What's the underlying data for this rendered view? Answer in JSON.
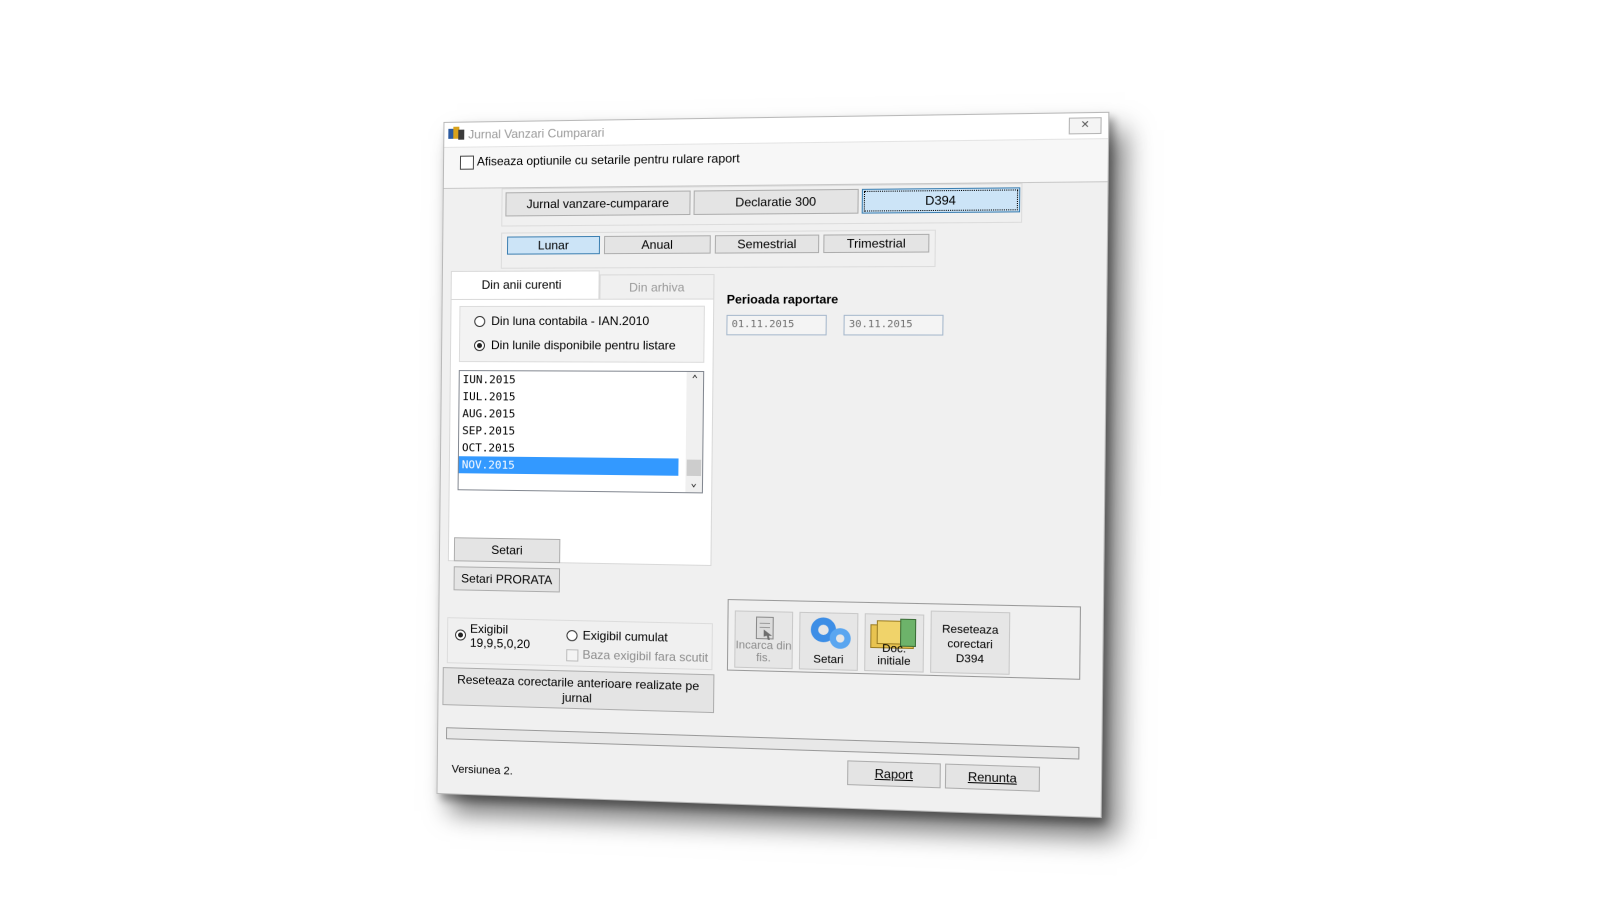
{
  "window": {
    "title": "Jurnal Vanzari Cumparari",
    "close_glyph": "✕"
  },
  "options": {
    "show_settings_label": "Afiseaza optiunile cu setarile pentru rulare raport",
    "checked": false
  },
  "report_types": [
    "Jurnal vanzare-cumparare",
    "Declaratie 300",
    "D394"
  ],
  "selected_report_type": "D394",
  "periods": [
    "Lunar",
    "Anual",
    "Semestrial",
    "Trimestrial"
  ],
  "selected_period": "Lunar",
  "tabs": [
    "Din anii curenti",
    "Din arhiva"
  ],
  "source": {
    "radio_contabila": "Din luna contabila - IAN.2010",
    "radio_disponibile": "Din lunile disponibile pentru listare",
    "selected": "disponibile"
  },
  "months": [
    "IUN.2015",
    "IUL.2015",
    "AUG.2015",
    "SEP.2015",
    "OCT.2015",
    "NOV.2015"
  ],
  "selected_month": "NOV.2015",
  "reporting_period": {
    "label": "Perioada raportare",
    "from": "01.11.2015",
    "to": "30.11.2015"
  },
  "buttons": {
    "setari": "Setari",
    "setari_prorata": "Setari PRORATA",
    "reset_corectari": "Reseteaza corectarile anterioare realizate pe jurnal",
    "raport": "Raport",
    "renunta": "Renunta"
  },
  "exigibil": {
    "option1_line1": "Exigibil",
    "option1_line2": "19,9,5,0,20",
    "option2": "Exigibil cumulat",
    "baza_fara_scutit": "Baza exigibil fara scutit",
    "selected": "option1"
  },
  "tools": [
    {
      "label": "Incarca din fis.",
      "icon": "document-load-icon",
      "enabled": false
    },
    {
      "label": "Setari",
      "icon": "gears-icon",
      "enabled": true
    },
    {
      "label": "Doc. initiale",
      "icon": "folders-icon",
      "enabled": true
    },
    {
      "label": "Reseteaza corectari D394",
      "icon": "",
      "enabled": true
    }
  ],
  "version": "Versiunea 2.",
  "progress": 0
}
